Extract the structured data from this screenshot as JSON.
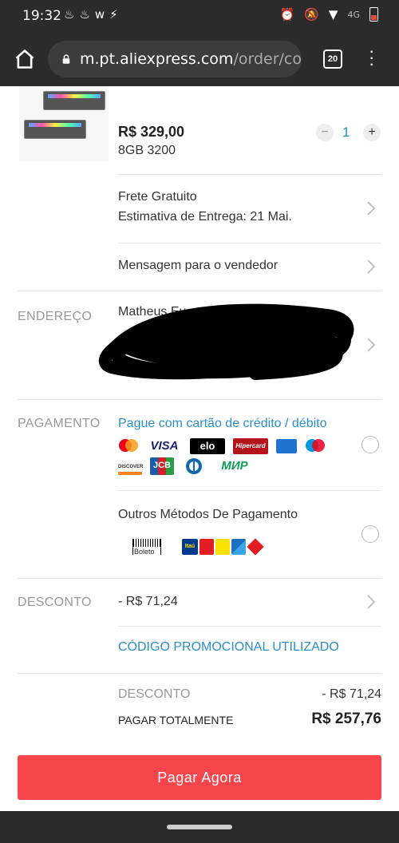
{
  "status_bar": {
    "time": "19:32",
    "network": "4G"
  },
  "browser": {
    "url_host": "m.pt.aliexpress.com",
    "url_path": "/order/co",
    "tab_count": "20"
  },
  "product": {
    "price": "R$ 329,00",
    "variant": "8GB 3200",
    "quantity": "1",
    "minus": "−",
    "plus": "+"
  },
  "shipping": {
    "line1": "Frete Gratuito",
    "line2": "Estimativa de Entrega: 21 Mai."
  },
  "seller_message": {
    "label": "Mensagem para o vendedor"
  },
  "address": {
    "label": "ENDEREÇO",
    "name_visible": "Matheus Eu"
  },
  "payment": {
    "label": "PAGAMENTO",
    "card_option": "Pague com cartão de crédito / débito",
    "card_brands": [
      "VISA",
      "elo",
      "Hipercard",
      "DISCOVER",
      "JCB",
      "МИР"
    ],
    "other_option": "Outros Métodos De Pagamento",
    "boleto": "Boleto",
    "bank_icons": [
      "Itaú"
    ]
  },
  "discount": {
    "label": "DESCONTO",
    "value": "- R$ 71,24",
    "promo_link": "CÓDIGO PROMOCIONAL UTILIZADO"
  },
  "summary": {
    "discount_label": "DESCONTO",
    "discount_value": "- R$ 71,24",
    "total_label": "PAGAR TOTALMENTE",
    "total_value": "R$ 257,76"
  },
  "pay_button": {
    "label": "Pagar Agora"
  },
  "colors": {
    "accent": "#f6454b",
    "link": "#2a8fc7",
    "dark_bar": "#2b2b2b"
  }
}
